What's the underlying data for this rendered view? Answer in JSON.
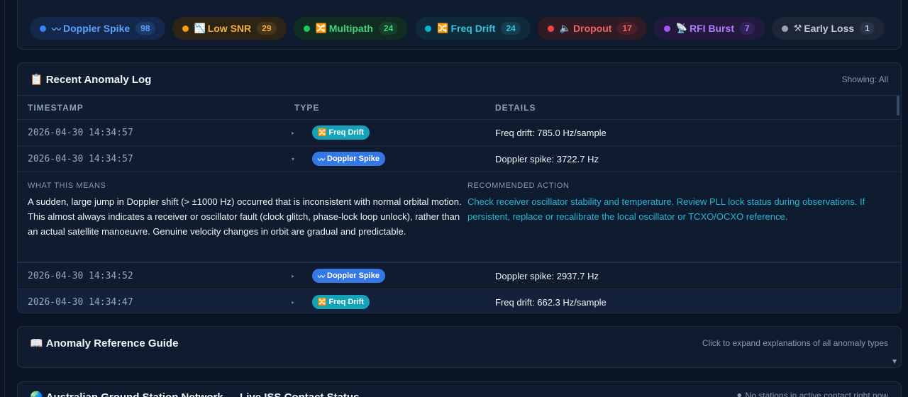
{
  "chips": [
    {
      "glyph": "〰",
      "label": "Doppler Spike",
      "count": "98",
      "dot": "#3b82f6",
      "color": "#5aa0ff",
      "bg": "#13284a",
      "countBg": "#1c3a66"
    },
    {
      "glyph": "📉",
      "label": "Low SNR",
      "count": "29",
      "dot": "#f59e0b",
      "color": "#f5b03a",
      "bg": "#2e2416",
      "countBg": "#45341a"
    },
    {
      "glyph": "🔀",
      "label": "Multipath",
      "count": "24",
      "dot": "#22c55e",
      "color": "#3fd07a",
      "bg": "#112c22",
      "countBg": "#17402c"
    },
    {
      "glyph": "🔀",
      "label": "Freq Drift",
      "count": "24",
      "dot": "#06b6d4",
      "color": "#2fc3e0",
      "bg": "#0f2a3a",
      "countBg": "#153e52"
    },
    {
      "glyph": "🔈",
      "label": "Dropout",
      "count": "17",
      "dot": "#ef4444",
      "color": "#f06363",
      "bg": "#301a24",
      "countBg": "#4a1f2a"
    },
    {
      "glyph": "📡",
      "label": "RFI Burst",
      "count": "7",
      "dot": "#a855f7",
      "color": "#b57bff",
      "bg": "#221a3c",
      "countBg": "#32225a"
    },
    {
      "glyph": "⚒",
      "label": "Early Loss",
      "count": "1",
      "dot": "#9ca3af",
      "color": "#c3cad6",
      "bg": "#1d2636",
      "countBg": "#29344a"
    }
  ],
  "log": {
    "glyph": "📋",
    "title": "Recent Anomaly Log",
    "showing": "Showing: All",
    "columns": {
      "timestamp": "TIMESTAMP",
      "type": "TYPE",
      "details": "DETAILS"
    },
    "rows": [
      {
        "ts": "2026-04-30 14:34:57",
        "arrow": "▸",
        "type": "Freq Drift",
        "glyph": "🔀",
        "kind": "freq",
        "details": "Freq drift: 785.0 Hz/sample"
      },
      {
        "ts": "2026-04-30 14:34:57",
        "arrow": "▾",
        "type": "Doppler Spike",
        "glyph": "〰",
        "kind": "doppler",
        "details": "Doppler spike: 3722.7 Hz"
      },
      {
        "ts": "2026-04-30 14:34:52",
        "arrow": "▸",
        "type": "Doppler Spike",
        "glyph": "〰",
        "kind": "doppler",
        "details": "Doppler spike: 2937.7 Hz"
      },
      {
        "ts": "2026-04-30 14:34:47",
        "arrow": "▸",
        "type": "Freq Drift",
        "glyph": "🔀",
        "kind": "freq",
        "details": "Freq drift: 662.3 Hz/sample"
      }
    ],
    "expanded": {
      "meaning_label": "WHAT THIS MEANS",
      "meaning": "A sudden, large jump in Doppler shift (> ±1000 Hz) occurred that is inconsistent with normal orbital motion. This almost always indicates a receiver or oscillator fault (clock glitch, phase-lock loop unlock), rather than an actual satellite manoeuvre. Genuine velocity changes in orbit are gradual and predictable.",
      "action_label": "RECOMMENDED ACTION",
      "action": "Check receiver oscillator stability and temperature. Review PLL lock status during observations. If persistent, replace or recalibrate the local oscillator or TCXO/OCXO reference."
    }
  },
  "guide": {
    "glyph": "📖",
    "title": "Anomaly Reference Guide",
    "hint": "Click to expand explanations of all anomaly types",
    "toggle": "▼"
  },
  "network": {
    "glyph": "🌏",
    "title": "Australian Ground Station Network — Live ISS Contact Status",
    "status": "⚫ No stations in active contact right now"
  }
}
